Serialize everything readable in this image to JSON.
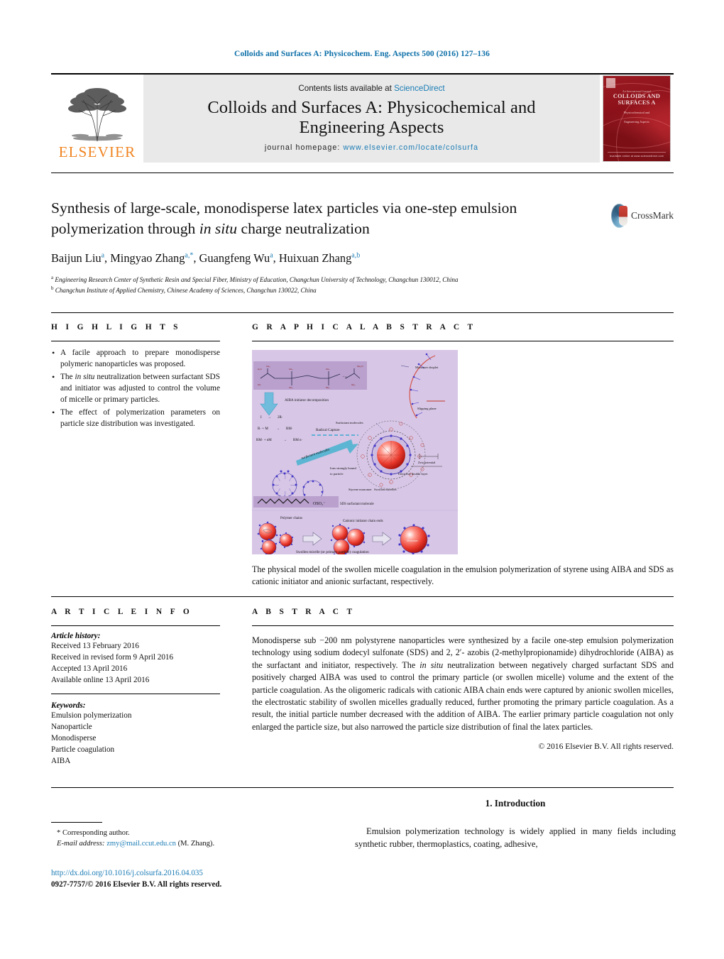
{
  "running_head": "Colloids and Surfaces A: Physicochem. Eng. Aspects 500 (2016) 127–136",
  "masthead": {
    "publisher": "ELSEVIER",
    "contents_prefix": "Contents lists available at ",
    "contents_link": "ScienceDirect",
    "journal_title_line1": "Colloids and Surfaces A: Physicochemical and",
    "journal_title_line2": "Engineering Aspects",
    "homepage_label": "journal homepage:",
    "homepage_url": "www.elsevier.com/locate/colsurfa",
    "cover": {
      "kicker": "An International Journal",
      "main_line1": "COLLOIDS AND",
      "main_line2": "SURFACES A",
      "sub_line1": "Physicochemical and",
      "sub_line2": "Engineering Aspects",
      "footer": "Available online at www.sciencedirect.com"
    }
  },
  "article": {
    "title_part1": "Synthesis of large-scale, monodisperse latex particles via one-step emulsion polymerization through ",
    "title_italic": "in situ",
    "title_part2": " charge neutralization",
    "crossmark_label": "CrossMark",
    "authors": [
      {
        "name": "Baijun Liu",
        "sup": "a"
      },
      {
        "name": "Mingyao Zhang",
        "sup": "a,*"
      },
      {
        "name": "Guangfeng Wu",
        "sup": "a"
      },
      {
        "name": "Huixuan Zhang",
        "sup": "a,b"
      }
    ],
    "affiliations": [
      {
        "sup": "a",
        "text": "Engineering Research Center of Synthetic Resin and Special Fiber, Ministry of Education, Changchun University of Technology, Changchun 130012, China"
      },
      {
        "sup": "b",
        "text": "Changchun Institute of Applied Chemistry, Chinese Academy of Sciences, Changchun 130022, China"
      }
    ]
  },
  "highlights": {
    "heading": "H I G H L I G H T S",
    "items": [
      {
        "pre": "A facile approach to prepare monodisperse polymeric nanoparticles was proposed."
      },
      {
        "pre": "The ",
        "italic": "in situ",
        "post": " neutralization between surfactant SDS and initiator was adjusted to control the volume of micelle or primary particles."
      },
      {
        "pre": "The effect of polymerization parameters on particle size distribution was investigated."
      }
    ]
  },
  "graphical_abstract": {
    "heading": "G R A P H I C A L   A B S T R A C T",
    "caption": "The physical model of the swollen micelle coagulation in the emulsion polymerization of styrene using AIBA and SDS as cationic initiator and anionic surfactant, respectively.",
    "figure_labels": {
      "aiba_decomposition": "AIBA initiator decomposition",
      "radical_capture": "Radical Capture",
      "surfactant_molecules": "Surfactant molecules",
      "surfactant_molecules2": "surfactant molecules",
      "monomer_droplet": "Monomer droplet",
      "slipping_plane": "Slipping plane",
      "zeta_potential": "Zeta potential",
      "electrical_double_layer": "Electrical double layer",
      "ions_bound": "Ions strongly bound to particle",
      "styrene_monomer": "Styrene monomer",
      "swollen_micelles": "Swollen micelles",
      "sds_molecule": "SDS surfactant molecule",
      "oso3": "OSO₃⁻",
      "polymer_chains": "Polymer chains",
      "cationic_ends": "Cationic initiator chain ends",
      "coagulation": "Swollen micelle (or primary particle) coagulation",
      "eq1": "I → 2R·",
      "eq2": "R· + M → RM·",
      "eq3": "RM· + nM → RM n·"
    },
    "figure_colors": {
      "background": "#d7c6e6",
      "panel": "#b9a0cd",
      "particle_core": "#e03024",
      "micelle_ring": "#3b2fa8",
      "arrow": "#5bb4d8"
    }
  },
  "article_info": {
    "heading": "A R T I C L E   I N F O",
    "history_label": "Article history:",
    "history": [
      "Received 13 February 2016",
      "Received in revised form 9 April 2016",
      "Accepted 13 April 2016",
      "Available online 13 April 2016"
    ],
    "keywords_label": "Keywords:",
    "keywords": [
      "Emulsion polymerization",
      "Nanoparticle",
      "Monodisperse",
      "Particle coagulation",
      "AIBA"
    ]
  },
  "abstract": {
    "heading": "A B S T R A C T",
    "p1": "Monodisperse sub −200 nm polystyrene nanoparticles were synthesized by a facile one-step emulsion polymerization technology using sodium dodecyl sulfonate (SDS) and 2, 2′- azobis (2-methylpropionamide) dihydrochloride (AIBA) as the surfactant and initiator, respectively. The ",
    "italic": "in situ",
    "p2": " neutralization between negatively charged surfactant SDS and positively charged AIBA was used to control the primary particle (or swollen micelle) volume and the extent of the particle coagulation. As the oligomeric radicals with cationic AIBA chain ends were captured by anionic swollen micelles, the electrostatic stability of swollen micelles gradually reduced, further promoting the primary particle coagulation. As a result, the initial particle number decreased with the addition of AIBA. The earlier primary particle coagulation not only enlarged the particle size, but also narrowed the particle size distribution of final the latex particles.",
    "copyright": "© 2016 Elsevier B.V. All rights reserved."
  },
  "footer": {
    "corresponding_marker": "*",
    "corresponding_text": "Corresponding author.",
    "email_label": "E-mail address:",
    "email": "zmy@mail.ccut.edu.cn",
    "email_suffix": "(M. Zhang).",
    "doi": "http://dx.doi.org/10.1016/j.colsurfa.2016.04.035",
    "issn": "0927-7757/© 2016 Elsevier B.V. All rights reserved."
  },
  "introduction": {
    "heading": "1.  Introduction",
    "paragraph": "Emulsion polymerization technology is widely applied in many fields including synthetic rubber, thermoplastics, coating, adhesive,"
  }
}
